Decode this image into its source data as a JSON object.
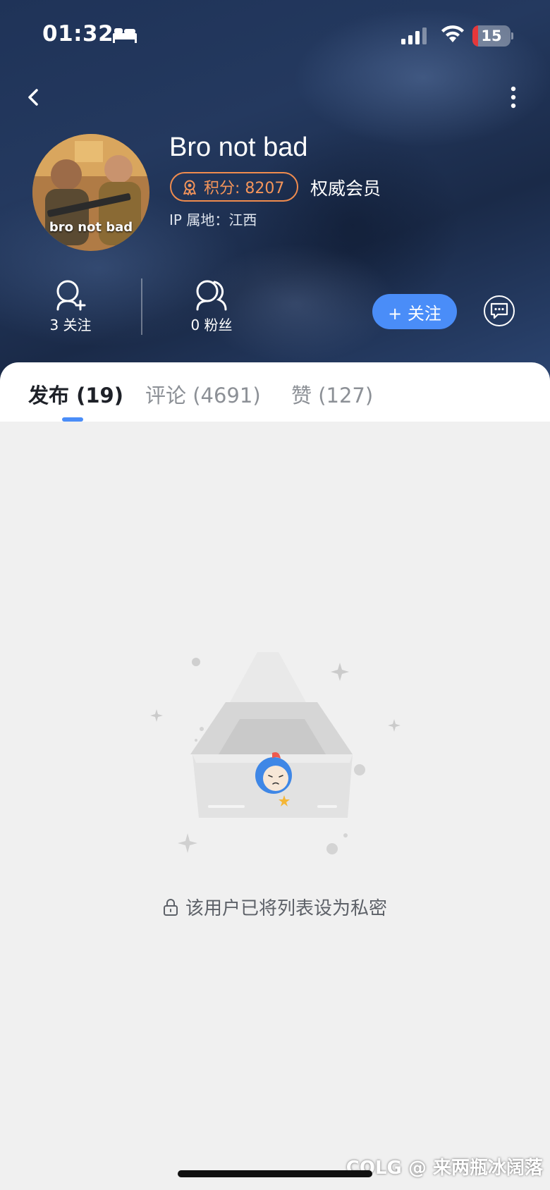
{
  "status_bar": {
    "time": "01:32",
    "battery_level": "15",
    "battery_color": "#e5373a",
    "icons": [
      "bed-icon",
      "signal-icon",
      "wifi-icon",
      "battery-icon"
    ]
  },
  "nav": {
    "back_icon": "chevron-left-icon",
    "more_icon": "more-vertical-icon"
  },
  "profile": {
    "avatar_caption": "bro not bad",
    "username": "Bro not bad",
    "points_label": "积分: 8207",
    "member_label": "权威会员",
    "ip_location": "IP 属地：江西"
  },
  "stats": {
    "following_label": "3 关注",
    "fans_label": "0 粉丝"
  },
  "actions": {
    "follow_label": "+ 关注",
    "message_icon": "chat-bubble-icon"
  },
  "tabs": [
    {
      "label": "发布 (19)",
      "active": true
    },
    {
      "label": "评论 (4691)",
      "active": false
    },
    {
      "label": "赞 (127)",
      "active": false
    }
  ],
  "empty_state": {
    "message": "该用户已将列表设为私密"
  },
  "watermark": "COLG @ 来两瓶冰阔落",
  "colors": {
    "accent": "#4a8df8",
    "points_orange": "#f08c4e",
    "header_dark": "#1f3358"
  }
}
